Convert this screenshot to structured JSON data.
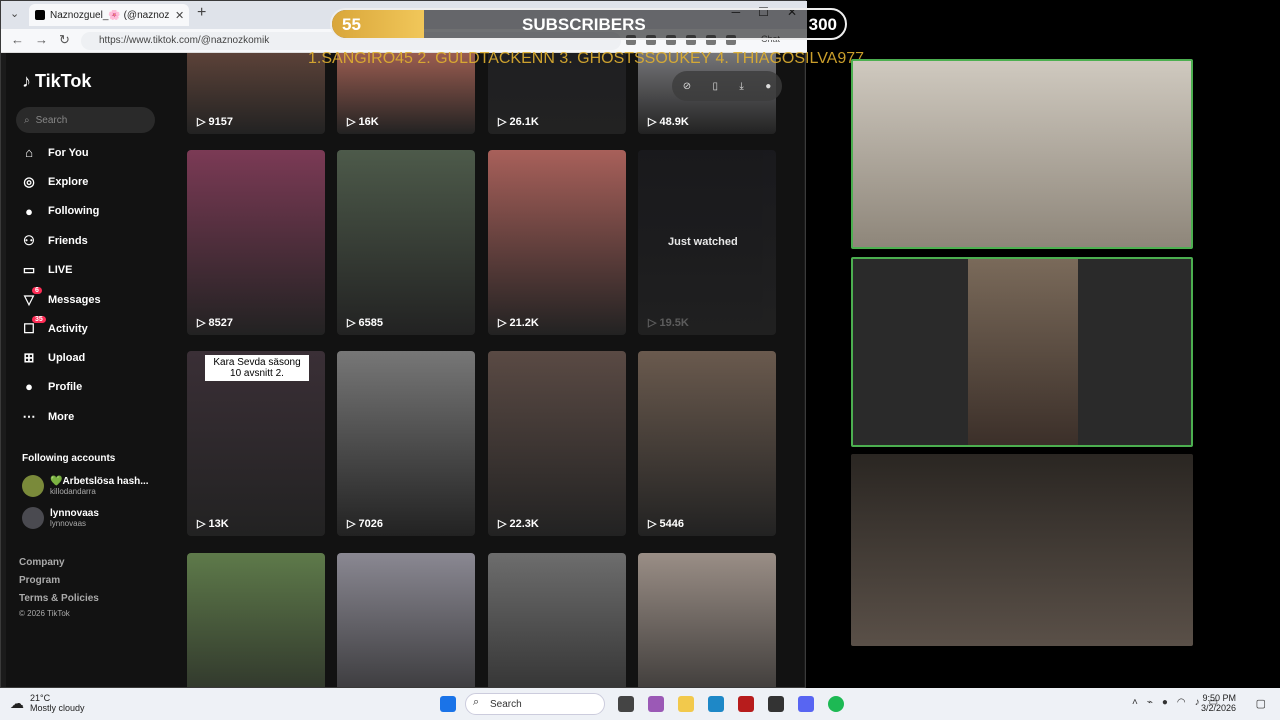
{
  "browser": {
    "tab_title": "Naznozguel_🌸 (@naznozkomik",
    "url": "https://www.tiktok.com/@naznozkomik",
    "copilot_label": "Chat"
  },
  "overlay": {
    "sub_current": "55",
    "sub_label": "SUBSCRIBERS",
    "sub_goal": "300",
    "sub_progress": 0.18,
    "ticker": "1.SANGIRO45  2. GULDTACKENN 3. GHOSTSSOUKEY 4. THIAGOSILVA977"
  },
  "tiktok": {
    "logo": "TikTok",
    "search_placeholder": "Search",
    "nav": [
      {
        "label": "For You",
        "icon": "home-icon"
      },
      {
        "label": "Explore",
        "icon": "compass-icon"
      },
      {
        "label": "Following",
        "icon": "avatar-icon"
      },
      {
        "label": "Friends",
        "icon": "friends-icon"
      },
      {
        "label": "LIVE",
        "icon": "live-icon"
      },
      {
        "label": "Messages",
        "icon": "messages-icon",
        "badge": "6"
      },
      {
        "label": "Activity",
        "icon": "activity-icon",
        "badge": "35"
      },
      {
        "label": "Upload",
        "icon": "upload-icon"
      },
      {
        "label": "Profile",
        "icon": "profile-icon"
      },
      {
        "label": "More",
        "icon": "more-icon"
      }
    ],
    "following_title": "Following accounts",
    "accounts": [
      {
        "name": "💚Arbetslösa hash...",
        "user": "killodandarra"
      },
      {
        "name": "lynnovaas",
        "user": "lynnovaas"
      }
    ],
    "footer": [
      "Company",
      "Program",
      "Terms & Policies"
    ],
    "copyright": "© 2026 TikTok",
    "videos": [
      {
        "count": "9157",
        "color": "#6a4a3e"
      },
      {
        "count": "16K",
        "color": "#b86b5c"
      },
      {
        "count": "26.1K",
        "color": "#1e1e22"
      },
      {
        "count": "48.9K",
        "color": "#8a8a8e"
      },
      {
        "count": "8527",
        "color": "#7b3a55"
      },
      {
        "count": "6585",
        "color": "#4d5a4a"
      },
      {
        "count": "21.2K",
        "color": "#a8605a"
      },
      {
        "count": "19.5K",
        "label": "Just watched",
        "color": "#1a1a1e"
      },
      {
        "count": "13K",
        "color": "#3a2f36",
        "caption": "Kara Sevda säsong 10 avsnitt 2."
      },
      {
        "count": "7026",
        "color": "#777"
      },
      {
        "count": "22.3K",
        "color": "#5a4a44"
      },
      {
        "count": "5446",
        "color": "#6a5a4e"
      },
      {
        "count": "",
        "color": "#5e7a4a"
      },
      {
        "count": "",
        "color": "#8a8892"
      },
      {
        "count": "",
        "color": "#6d6d6d"
      },
      {
        "count": "",
        "color": "#9a8e86"
      }
    ]
  },
  "taskbar": {
    "temp": "21°C",
    "weather": "Mostly cloudy",
    "search": "Search",
    "time": "9:50 PM",
    "date": "3/2/2026"
  }
}
